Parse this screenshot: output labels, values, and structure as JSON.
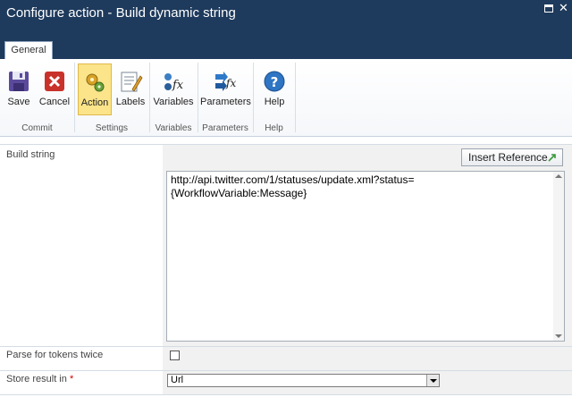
{
  "window": {
    "title": "Configure action - Build dynamic string"
  },
  "tabs": [
    {
      "label": "General",
      "selected": true
    }
  ],
  "ribbon": {
    "groups": [
      {
        "label": "Commit",
        "buttons": [
          {
            "label": "Save",
            "icon": "save-icon"
          },
          {
            "label": "Cancel",
            "icon": "cancel-icon"
          }
        ]
      },
      {
        "label": "Settings",
        "buttons": [
          {
            "label": "Action",
            "icon": "action-gear-icon",
            "active": true
          },
          {
            "label": "Labels",
            "icon": "labels-icon"
          }
        ]
      },
      {
        "label": "Variables",
        "buttons": [
          {
            "label": "Variables",
            "icon": "variables-fx-icon"
          }
        ]
      },
      {
        "label": "Parameters",
        "buttons": [
          {
            "label": "Parameters",
            "icon": "parameters-fx-icon"
          }
        ]
      },
      {
        "label": "Help",
        "buttons": [
          {
            "label": "Help",
            "icon": "help-icon"
          }
        ]
      }
    ]
  },
  "form": {
    "build_string": {
      "label": "Build string",
      "insert_reference_label": "Insert Reference",
      "value_line1": "http://api.twitter.com/1/statuses/update.xml?status=",
      "value_line2": "{WorkflowVariable:Message}"
    },
    "parse_tokens": {
      "label": "Parse for tokens twice",
      "checked": false
    },
    "store_result": {
      "label": "Store result in",
      "required_marker": "*",
      "selected": "Url"
    }
  },
  "colors": {
    "titlebar": "#1e3a5c",
    "active_button": "#fbe48a",
    "value_column": "#f1f1f1"
  }
}
